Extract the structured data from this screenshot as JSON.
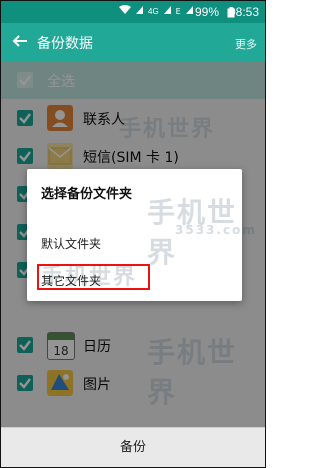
{
  "status": {
    "battery": "99%",
    "time": "08:53",
    "network": "4G"
  },
  "header": {
    "title": "备份数据",
    "more": "更多"
  },
  "select_all": "全选",
  "items": [
    {
      "label": "联系人",
      "icon": "contacts-icon",
      "color": "#e4863a"
    },
    {
      "label": "短信(SIM 卡 1)",
      "icon": "messages-icon",
      "color": "#f2d27a"
    },
    {
      "label": "",
      "icon": "hidden-icon",
      "color": "#f2d27a"
    },
    {
      "label": "",
      "icon": "hidden-icon",
      "color": "#7fbf6a"
    },
    {
      "label": "",
      "icon": "hidden-icon",
      "color": "#3f8fd9"
    },
    {
      "label": "日历",
      "icon": "calendar-icon",
      "color": "#5a8f52"
    },
    {
      "label": "图片",
      "icon": "gallery-icon",
      "color": "#3a86d6"
    }
  ],
  "dialog": {
    "title": "选择备份文件夹",
    "option1": "默认文件夹",
    "option2": "其它文件夹"
  },
  "bottom": {
    "backup": "备份"
  },
  "watermarks": [
    "手机世界",
    "3533.com"
  ]
}
